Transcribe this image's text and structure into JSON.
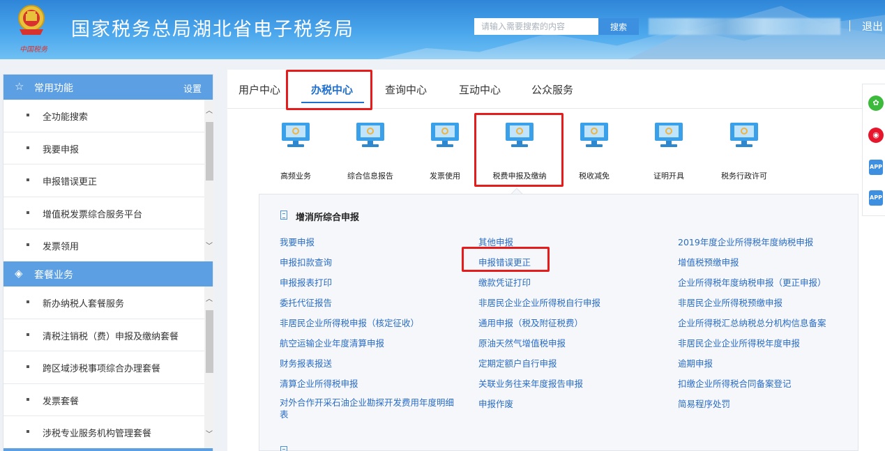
{
  "header": {
    "site_title": "国家税务总局湖北省电子税务局",
    "brand_text": "中国税务",
    "search_placeholder": "请输入需要搜索的内容",
    "search_button": "搜索",
    "logout": "退出",
    "emblem_icon": "national-emblem-icon"
  },
  "sidebar": {
    "section1": {
      "title": "常用功能",
      "action": "设置",
      "icon": "star-icon",
      "items": [
        "全功能搜索",
        "我要申报",
        "申报错误更正",
        "增值税发票综合服务平台",
        "发票领用"
      ]
    },
    "section2": {
      "title": "套餐业务",
      "icon": "layers-icon",
      "items": [
        "新办纳税人套餐服务",
        "清税注销税（费）申报及缴纳套餐",
        "跨区域涉税事项综合办理套餐",
        "发票套餐",
        "涉税专业服务机构管理套餐"
      ]
    }
  },
  "tabs": [
    "用户中心",
    "办税中心",
    "查询中心",
    "互动中心",
    "公众服务"
  ],
  "active_tab": "办税中心",
  "categories": [
    "高频业务",
    "综合信息报告",
    "发票使用",
    "税费申报及缴纳",
    "税收减免",
    "证明开具",
    "税务行政许可"
  ],
  "active_category": "税费申报及缴纳",
  "panel": {
    "group_title": "增消所综合申报",
    "col1": [
      "我要申报",
      "申报扣款查询",
      "申报报表打印",
      "委托代征报告",
      "非居民企业所得税申报（核定征收）",
      "航空运输企业年度清算申报",
      "财务报表报送",
      "清算企业所得税申报",
      "对外合作开采石油企业勘探开发费用年度明细表"
    ],
    "col2": [
      "其他申报",
      "申报错误更正",
      "缴款凭证打印",
      "非居民企业企业所得税自行申报",
      "通用申报（税及附征税费）",
      "原油天然气增值税申报",
      "定期定额户自行申报",
      "关联业务往来年度报告申报",
      "申报作废"
    ],
    "col3": [
      "2019年度企业所得税年度纳税申报",
      "增值税预缴申报",
      "企业所得税年度纳税申报（更正申报）",
      "非居民企业所得税预缴申报",
      "企业所得税汇总纳税总分机构信息备案",
      "非居民企业企业所得税年度申报",
      "逾期申报",
      "扣缴企业所得税合同备案登记",
      "简易程序处罚"
    ]
  },
  "float_icons": [
    "wechat-icon",
    "weibo-icon",
    "app-icon",
    "app-icon"
  ],
  "colors": {
    "header_blue": "#2f86d8",
    "sidebar_section": "#5c9fe2",
    "link_blue": "#2a6cc5",
    "highlight_red": "#e51c1c"
  }
}
